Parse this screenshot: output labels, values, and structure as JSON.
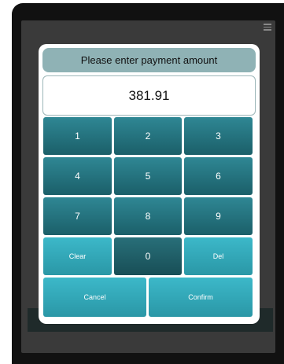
{
  "dialog": {
    "title": "Please enter payment amount",
    "amount": "381.91"
  },
  "keypad": {
    "rows": [
      [
        "1",
        "2",
        "3"
      ],
      [
        "4",
        "5",
        "6"
      ],
      [
        "7",
        "8",
        "9"
      ]
    ],
    "clear_label": "Clear",
    "zero_label": "0",
    "del_label": "Del",
    "cancel_label": "Cancel",
    "confirm_label": "Confirm"
  }
}
